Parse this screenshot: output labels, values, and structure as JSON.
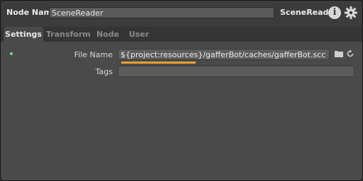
{
  "header": {
    "node_name_label": "Node Name",
    "node_name_value": "SceneReader",
    "node_type": "SceneReader",
    "info_glyph": "i",
    "icons": [
      "info-icon",
      "gear-icon"
    ]
  },
  "tabs": [
    {
      "label": "Settings",
      "active": true
    },
    {
      "label": "Transform",
      "active": false
    },
    {
      "label": "Node",
      "active": false
    },
    {
      "label": "User",
      "active": false
    }
  ],
  "settings": {
    "file_name": {
      "label": "File Name",
      "value": "${project:resources}/gafferBot/caches/gafferBot.scc",
      "icons": [
        "folder-icon",
        "reload-icon"
      ]
    },
    "tags": {
      "label": "Tags",
      "value": ""
    }
  },
  "colors": {
    "accent_underline": "#f0a030",
    "status_dot": "#7fd08e"
  }
}
